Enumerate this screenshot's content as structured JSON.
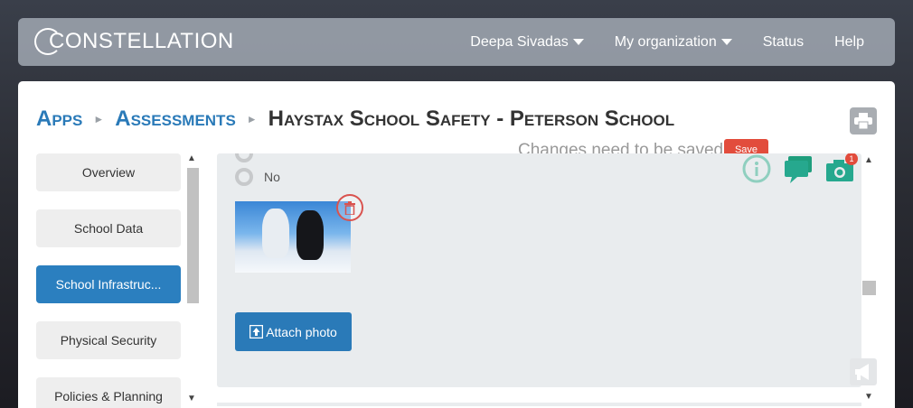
{
  "app": {
    "logo_text": "CONSTELLATION"
  },
  "nav": {
    "items": [
      {
        "label": "Deepa Sivadas",
        "dropdown": true
      },
      {
        "label": "My organization",
        "dropdown": true
      },
      {
        "label": "Status",
        "dropdown": false
      },
      {
        "label": "Help",
        "dropdown": false
      }
    ]
  },
  "breadcrumb": {
    "apps": "Apps",
    "assessments": "Assessments",
    "current": "Haystax School Safety - Peterson School",
    "separator": "►"
  },
  "status": {
    "changes_text": "Changes need to be saved",
    "save_label": "Save"
  },
  "sidebar": {
    "items": [
      {
        "label": "Overview",
        "active": false
      },
      {
        "label": "School Data",
        "active": false
      },
      {
        "label": "School Infrastruc...",
        "active": true
      },
      {
        "label": "Physical Security",
        "active": false
      },
      {
        "label": "Policies & Planning",
        "active": false
      }
    ]
  },
  "content": {
    "radio_option": "No",
    "attach_label": "Attach photo",
    "camera_badge": "1"
  },
  "colors": {
    "primary": "#2a7ab8",
    "active_sidebar": "#2b7fbf",
    "danger": "#e24c3c",
    "teal_icon": "#26a88e"
  }
}
